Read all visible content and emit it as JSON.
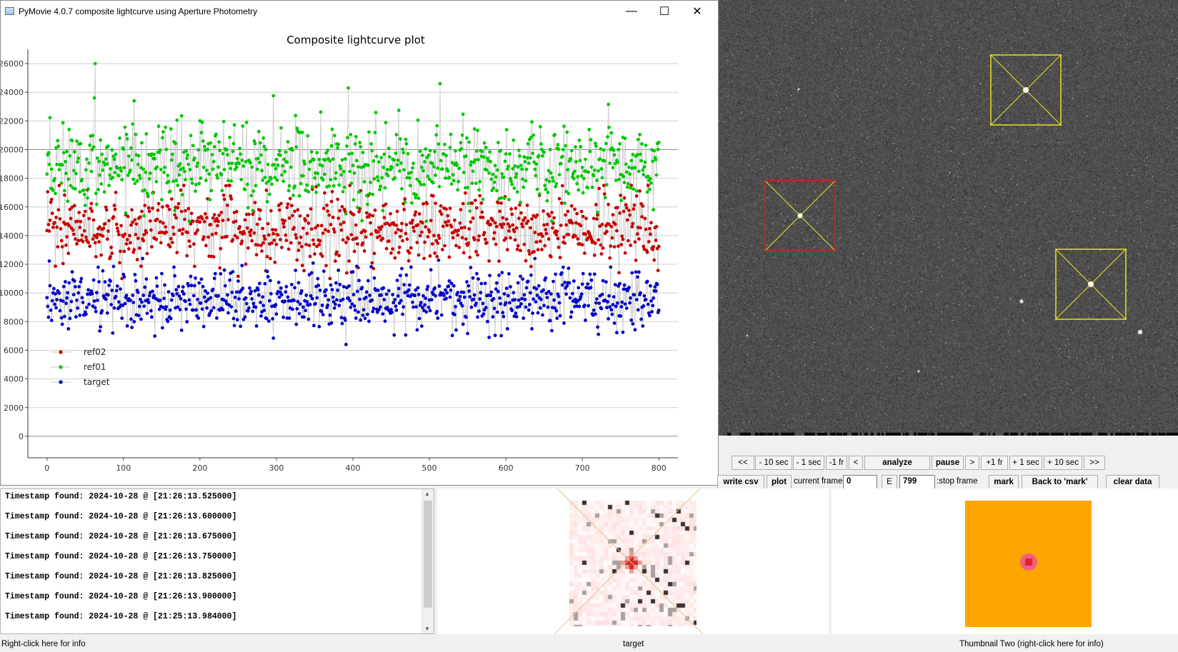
{
  "window": {
    "title": "PyMovie 4.0.7 composite lightcurve using Aperture Photometry",
    "minimize_glyph": "—",
    "maximize_glyph": "☐",
    "close_glyph": "✕"
  },
  "chart_data": {
    "type": "scatter",
    "title": "Composite lightcurve plot",
    "xlabel": "",
    "ylabel": "",
    "xlim": [
      -25,
      825
    ],
    "ylim": [
      -1500,
      27000
    ],
    "x_ticks": [
      0,
      100,
      200,
      300,
      400,
      500,
      600,
      700,
      800
    ],
    "y_ticks": [
      0,
      2000,
      4000,
      6000,
      8000,
      10000,
      12000,
      14000,
      16000,
      18000,
      20000,
      22000,
      24000,
      26000
    ],
    "grid": true,
    "legend_position": "bottom-left",
    "connecting_lines": true,
    "frames": [
      0,
      800
    ],
    "series": [
      {
        "name": "ref02",
        "color": "#c80000",
        "mean": 14500,
        "spread": 1300,
        "min": 11000,
        "max": 17500
      },
      {
        "name": "ref01",
        "color": "#00c800",
        "mean": 18900,
        "spread": 1400,
        "min": 15000,
        "max": 26000
      },
      {
        "name": "target",
        "color": "#0000c8",
        "mean": 9600,
        "spread": 1050,
        "min": 6400,
        "max": 12400
      }
    ]
  },
  "controls": {
    "nav_buttons": [
      "<<",
      "- 10 sec",
      "- 1 sec",
      "-1 fr",
      "<",
      "analyze",
      "pause",
      ">",
      "+1 fr",
      "+ 1 sec",
      "+ 10 sec",
      ">>"
    ],
    "write_csv": "write csv",
    "plot": "plot",
    "current_frame_label": "current frame:",
    "current_frame_value": "0",
    "e_button": "E",
    "stop_frame_value": "799",
    "stop_frame_label": ":stop frame",
    "mark": "mark",
    "back_to_mark": "Back to 'mark'",
    "clear_data": "clear data"
  },
  "log": {
    "lines": [
      "Timestamp found: 2024-10-28 @ [21:26:13.525000]",
      "Timestamp found: 2024-10-28 @ [21:26:13.600000]",
      "Timestamp found: 2024-10-28 @ [21:26:13.675000]",
      "Timestamp found: 2024-10-28 @ [21:26:13.750000]",
      "Timestamp found: 2024-10-28 @ [21:26:13.825000]",
      "Timestamp found: 2024-10-28 @ [21:26:13.900000]",
      "Timestamp found: 2024-10-28 @ [21:25:13.984000]"
    ],
    "scroll_up": "▲",
    "scroll_down": "▼"
  },
  "status": {
    "left": "Right-click here for info",
    "middle": "target",
    "right": "Thumbnail Two (right-click here for info)"
  },
  "colors": {
    "target_aperture": "#d42020",
    "ref_aperture": "#e8e020",
    "thumb_two_bg": "#ffa500"
  }
}
